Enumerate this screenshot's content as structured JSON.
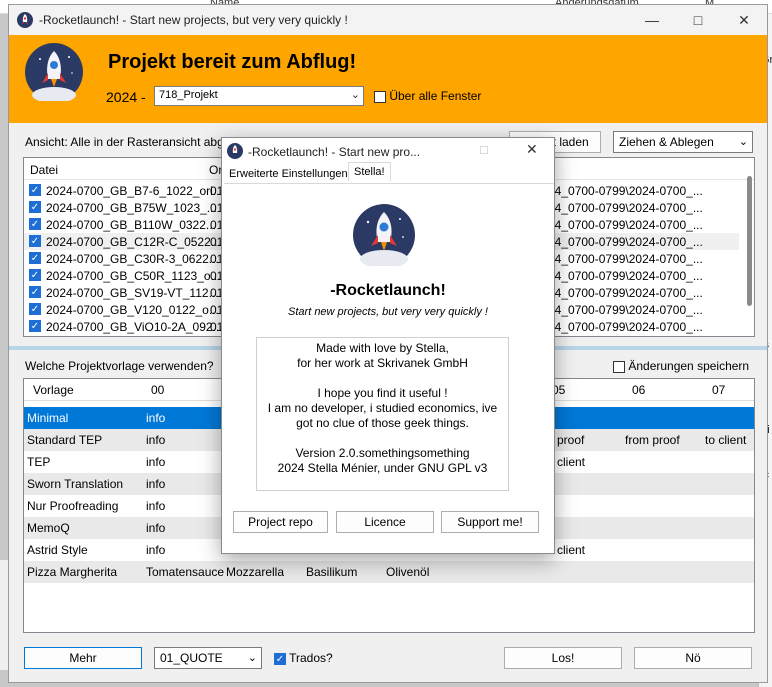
{
  "background": {
    "top_labels": [
      "Name",
      "Änderungsdatum",
      "M"
    ],
    "right_labels": [
      "Gr",
      "ls",
      "Ti",
      "ic"
    ]
  },
  "main": {
    "title": "-Rocketlaunch! - Start new projects, but very very quickly !",
    "header": {
      "headline": "Projekt bereit zum Abflug!",
      "year": "2024 -",
      "project_value": "718_Projekt",
      "always_on_top_label": "Über alle Fenster"
    },
    "view_label": "Ansicht: Alle in der Rasteransicht abgelegten Dateien",
    "load_button": "Export laden",
    "drag_mode": "Ziehen & Ablegen",
    "file_columns": [
      "Datei",
      "Or"
    ],
    "files": [
      {
        "name": "2024-0700_GB_B7-6_1022_ori...",
        "org": "01",
        "path": "F\\2024_0700-0799\\2024-0700_..."
      },
      {
        "name": "2024-0700_GB_B75W_1023_...",
        "org": "01",
        "path": "F\\2024_0700-0799\\2024-0700_..."
      },
      {
        "name": "2024-0700_GB_B110W_0322...",
        "org": "01",
        "path": "F\\2024_0700-0799\\2024-0700_..."
      },
      {
        "name": "2024-0700_GB_C12R-C_0522...",
        "org": "01",
        "path": "F\\2024_0700-0799\\2024-0700_..."
      },
      {
        "name": "2024-0700_GB_C30R-3_0622...",
        "org": "01",
        "path": "F\\2024_0700-0799\\2024-0700_..."
      },
      {
        "name": "2024-0700_GB_C50R_1123_o...",
        "org": "01",
        "path": "F\\2024_0700-0799\\2024-0700_..."
      },
      {
        "name": "2024-0700_GB_SV19-VT_112...",
        "org": "01",
        "path": "F\\2024_0700-0799\\2024-0700_..."
      },
      {
        "name": "2024-0700_GB_V120_0122_o...",
        "org": "01",
        "path": "F\\2024_0700-0799\\2024-0700_..."
      },
      {
        "name": "2024-0700_GB_ViO10-2A_092...",
        "org": "01",
        "path": "F\\2024_0700-0799\\2024-0700_..."
      }
    ],
    "template_question": "Welche Projektvorlage verwenden?",
    "save_changes_label": "Änderungen speichern",
    "grid_columns": [
      "Vorlage",
      "00",
      "05",
      "06",
      "07"
    ],
    "templates": [
      {
        "name": "Minimal",
        "c00": "info",
        "c05": "",
        "c06": "",
        "c07": ""
      },
      {
        "name": "Standard TEP",
        "c00": "info",
        "c05": "proof",
        "c06": "from proof",
        "c07": "to client"
      },
      {
        "name": "TEP",
        "c00": "info",
        "c05": "client",
        "c06": "",
        "c07": ""
      },
      {
        "name": "Sworn Translation",
        "c00": "info",
        "c05": "",
        "c06": "",
        "c07": ""
      },
      {
        "name": "Nur Proofreading",
        "c00": "info",
        "c05": "",
        "c06": "",
        "c07": ""
      },
      {
        "name": "MemoQ",
        "c00": "info",
        "c05": "",
        "c06": "",
        "c07": ""
      },
      {
        "name": "Astrid Style",
        "c00": "info",
        "c05": "client",
        "c06": "",
        "c07": ""
      },
      {
        "name": "Pizza Margherita",
        "c00": "Tomatensauce",
        "c01": "Mozzarella",
        "c02": "Basilikum",
        "c03": "Olivenöl",
        "c05": "",
        "c06": "",
        "c07": ""
      }
    ],
    "footer": {
      "more_button": "Mehr",
      "quote_value": "01_QUOTE",
      "trados_label": "Trados?",
      "go_button": "Los!",
      "no_button": "Nö"
    }
  },
  "dialog": {
    "title": "-Rocketlaunch! - Start new pro...",
    "tabs": [
      "Erweiterte Einstellungen",
      "Stella!"
    ],
    "app_name": "-Rocketlaunch!",
    "tagline": "Start new projects, but very very quickly !",
    "about_lines": [
      "Made with love by Stella,",
      "for her work at Skrivanek GmbH",
      "",
      "I hope you find it useful !",
      "I am no developer, i studied economics, ive",
      "got no clue of those geek things.",
      "",
      "Version 2.0.somethingsomething",
      "2024 Stella Ménier, under GNU GPL v3"
    ],
    "buttons": {
      "repo": "Project repo",
      "licence": "Licence",
      "support": "Support me!"
    }
  },
  "colors": {
    "accent": "#ffa500",
    "selection": "#0078d7",
    "rocket_bg": "#2a3a64"
  }
}
